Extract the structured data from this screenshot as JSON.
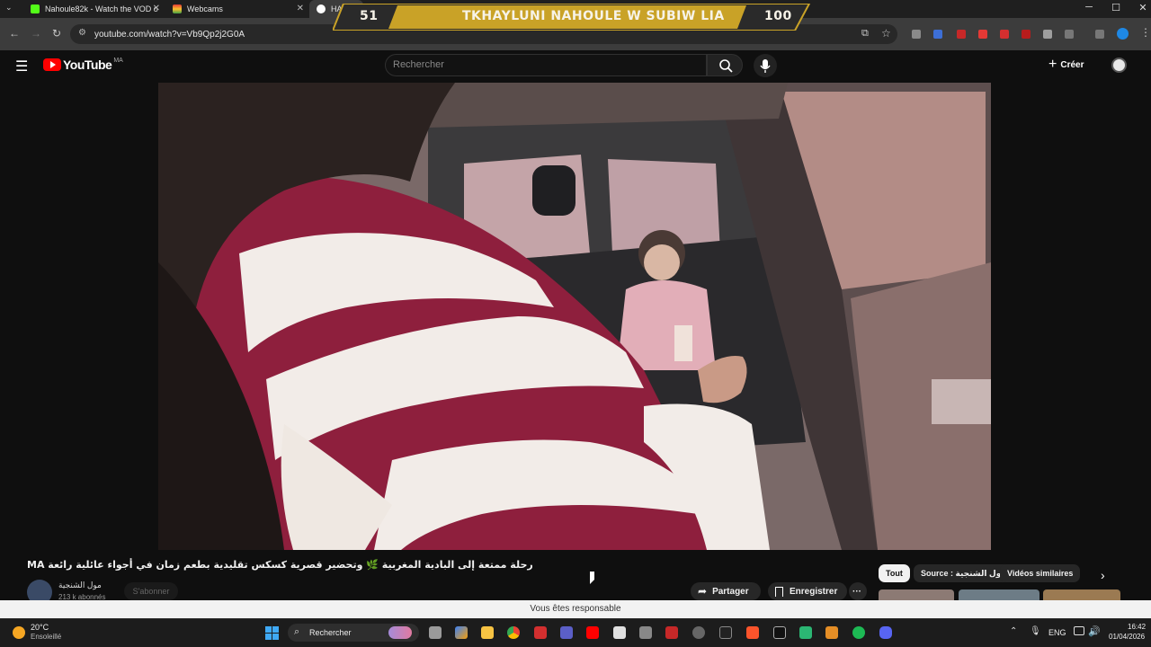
{
  "browser": {
    "tabs": [
      {
        "title": "Nahoule82k - Watch the VOD o",
        "color": "#53fc18"
      },
      {
        "title": "Webcams",
        "color": "#f5a623"
      },
      {
        "title": "HASBUL",
        "color": "#4285f4"
      }
    ],
    "url": "youtube.com/watch?v=Vb9Qp2j2G0A",
    "controls": {
      "minimize": "─",
      "maximize": "☐",
      "close": "✕"
    }
  },
  "overlay_banner": {
    "left_number": "51",
    "text": "TKHAYLUNI NAHOULE W SUBIW LIA",
    "right_number": "100"
  },
  "youtube": {
    "logo_text": "YouTube",
    "region": "MA",
    "search_placeholder": "Rechercher",
    "create_label": "Créer",
    "video": {
      "title": "رحلة ممتعة إلى البادية المغربية 🌿 وتحضير قصرية كسكس تقليدية بطعم زمان في أجواء عائلية رائعة MA",
      "channel": "مول الشنجية",
      "subscribers": "213 k abonnés",
      "subscribe_label": "S'abonner",
      "share_label": "Partager",
      "save_label": "Enregistrer",
      "more_label": "···"
    },
    "chips": [
      {
        "label": "Tout",
        "active": true
      },
      {
        "label": "Source : مول الشنجية",
        "active": false
      },
      {
        "label": "Vidéos similaires",
        "active": false
      }
    ],
    "notice": "Vous êtes responsable"
  },
  "taskbar": {
    "weather_temp": "20°C",
    "weather_desc": "Ensoleillé",
    "search_label": "Rechercher",
    "language": "ENG",
    "time": "16:42",
    "date": "01/04/2026"
  }
}
